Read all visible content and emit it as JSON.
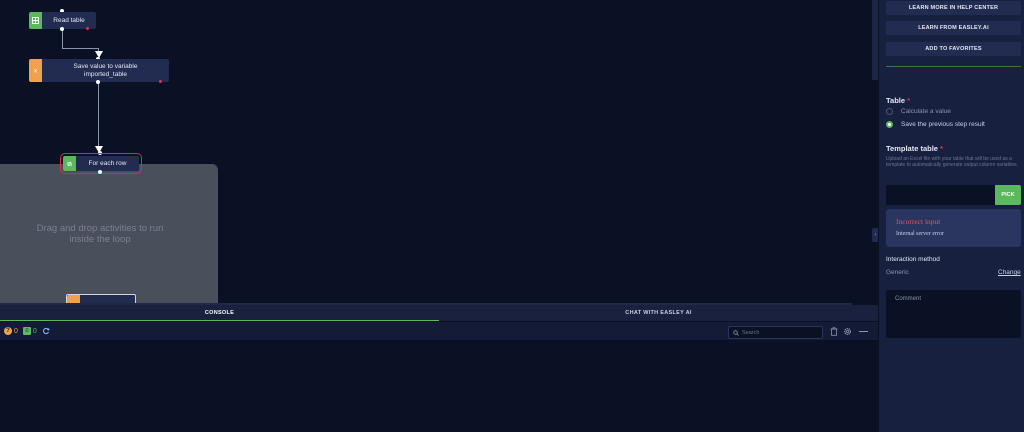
{
  "canvas": {
    "nodes": [
      {
        "label": "Read table",
        "type": "table",
        "color": "#5cb85c"
      },
      {
        "label": "Save value to variable\nimported_table",
        "type": "variable",
        "color": "#f0a24a"
      },
      {
        "label": "For each row",
        "type": "loop",
        "color": "#5cb85c",
        "selected": true
      }
    ],
    "loop_hint": "Drag and drop activities to run inside the loop"
  },
  "console": {
    "tabs": [
      {
        "label": "CONSOLE",
        "active": true
      },
      {
        "label": "CHAT WITH EASLEY AI",
        "active": false
      }
    ],
    "counts": {
      "warnings": "0",
      "messages": "0"
    },
    "search_placeholder": "Search"
  },
  "panel": {
    "buttons": [
      "LEARN MORE IN HELP CENTER",
      "LEARN FROM EASLEY.AI",
      "ADD TO FAVORITES"
    ],
    "table_section": {
      "title": "Table",
      "required_mark": "*",
      "options": [
        {
          "label": "Calculate a value",
          "checked": false
        },
        {
          "label": "Save the previous step result",
          "checked": true
        }
      ]
    },
    "template_section": {
      "title": "Template table",
      "required_mark": "*",
      "description": "Upload an Excel file with your table that will be used as a template to automatically generate output column variables.",
      "input_value": "",
      "pick_label": "PICK"
    },
    "error": {
      "title": "Incorrect input",
      "message": "Internal server error"
    },
    "interaction": {
      "label": "Interaction method",
      "value": "Generic",
      "change_label": "Change"
    },
    "comment_placeholder": "Comment"
  },
  "colors": {
    "accent": "#5cb85c",
    "error": "#e05a5a",
    "warning": "#f0a24a",
    "background": "#0b1124",
    "panel": "#182040"
  }
}
